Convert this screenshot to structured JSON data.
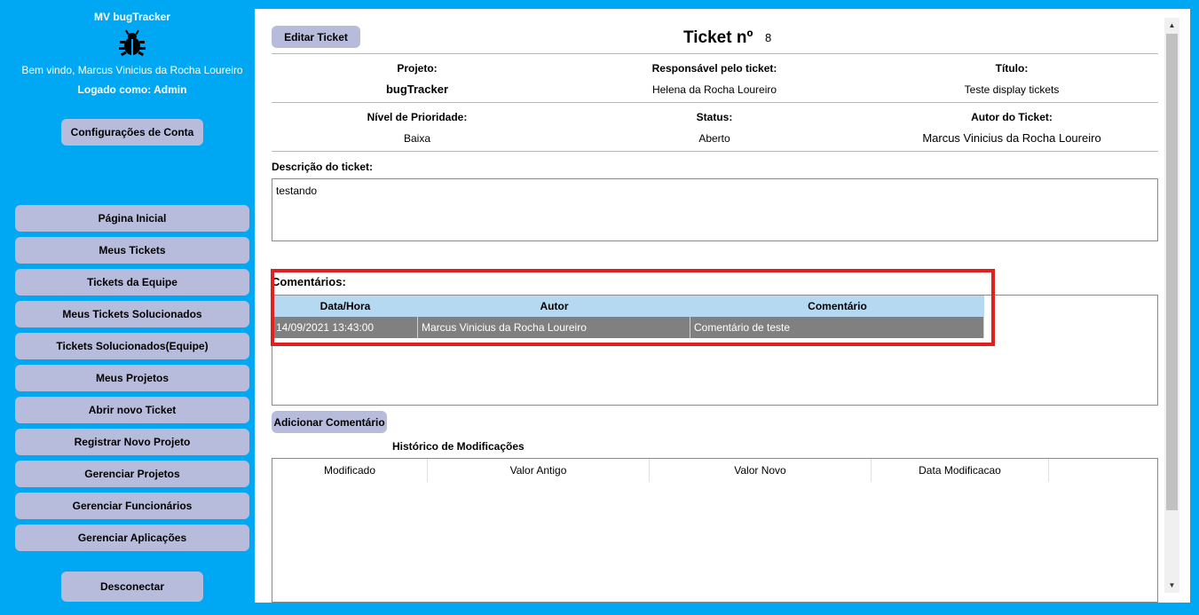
{
  "sidebar": {
    "app_title": "MV bugTracker",
    "welcome": "Bem vindo, Marcus Vinicius da Rocha Loureiro",
    "logged_as": "Logado como: Admin",
    "account_button": "Configurações de Conta",
    "items": [
      {
        "label": "Página Inicial"
      },
      {
        "label": "Meus Tickets"
      },
      {
        "label": "Tickets da Equipe"
      },
      {
        "label": "Meus Tickets Solucionados"
      },
      {
        "label": "Tickets Solucionados(Equipe)"
      },
      {
        "label": "Meus Projetos"
      },
      {
        "label": "Abrir novo Ticket"
      },
      {
        "label": "Registrar Novo Projeto"
      },
      {
        "label": "Gerenciar Projetos"
      },
      {
        "label": "Gerenciar Funcionários"
      },
      {
        "label": "Gerenciar Aplicações"
      }
    ],
    "disconnect_button": "Desconectar"
  },
  "ticket": {
    "edit_button": "Editar Ticket",
    "title": "Ticket nº",
    "number": "8",
    "project_label": "Projeto:",
    "project_value": "bugTracker",
    "responsible_label": "Responsável pelo ticket:",
    "responsible_value": "Helena da Rocha Loureiro",
    "title_label": "Título:",
    "title_value": "Teste display tickets",
    "priority_label": "Nível de Prioridade:",
    "priority_value": "Baixa",
    "status_label": "Status:",
    "status_value": "Aberto",
    "author_label": "Autor do Ticket:",
    "author_value": "Marcus Vinicius da Rocha Loureiro",
    "description_label": "Descrição do ticket:",
    "description_value": "testando"
  },
  "comments": {
    "label": "Comentários:",
    "columns": [
      "Data/Hora",
      "Autor",
      "Comentário"
    ],
    "rows": [
      [
        "14/09/2021 13:43:00",
        "Marcus Vinicius da Rocha Loureiro",
        "Comentário de teste"
      ]
    ],
    "add_button": "Adicionar Comentário"
  },
  "history": {
    "label": "Histórico de Modificações",
    "columns": [
      "Modificado",
      "Valor Antigo",
      "Valor Novo",
      "Data Modificacao"
    ]
  },
  "colors": {
    "background": "#00a8f3",
    "button": "#b8bcdc",
    "highlight": "#e02020",
    "table_header": "#b6d9f2",
    "selected_row": "#808080"
  }
}
